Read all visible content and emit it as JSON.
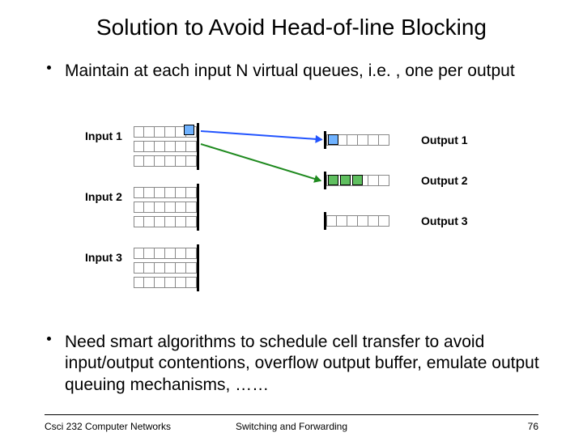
{
  "title": "Solution to Avoid Head-of-line Blocking",
  "bullets": {
    "b1": "Maintain at each input N virtual queues, i.e. , one per output",
    "b2": "Need smart algorithms to schedule cell transfer to avoid input/output contentions, overflow output buffer, emulate output queuing mechanisms, ……"
  },
  "inputs": {
    "i1": "Input 1",
    "i2": "Input 2",
    "i3": "Input 3"
  },
  "outputs": {
    "o1": "Output 1",
    "o2": "Output 2",
    "o3": "Output 3"
  },
  "footer": {
    "left": "Csci 232 Computer Networks",
    "center": "Switching and Forwarding",
    "right": "76"
  },
  "colors": {
    "blue": "#2254ff",
    "green": "#1f8a1f"
  }
}
